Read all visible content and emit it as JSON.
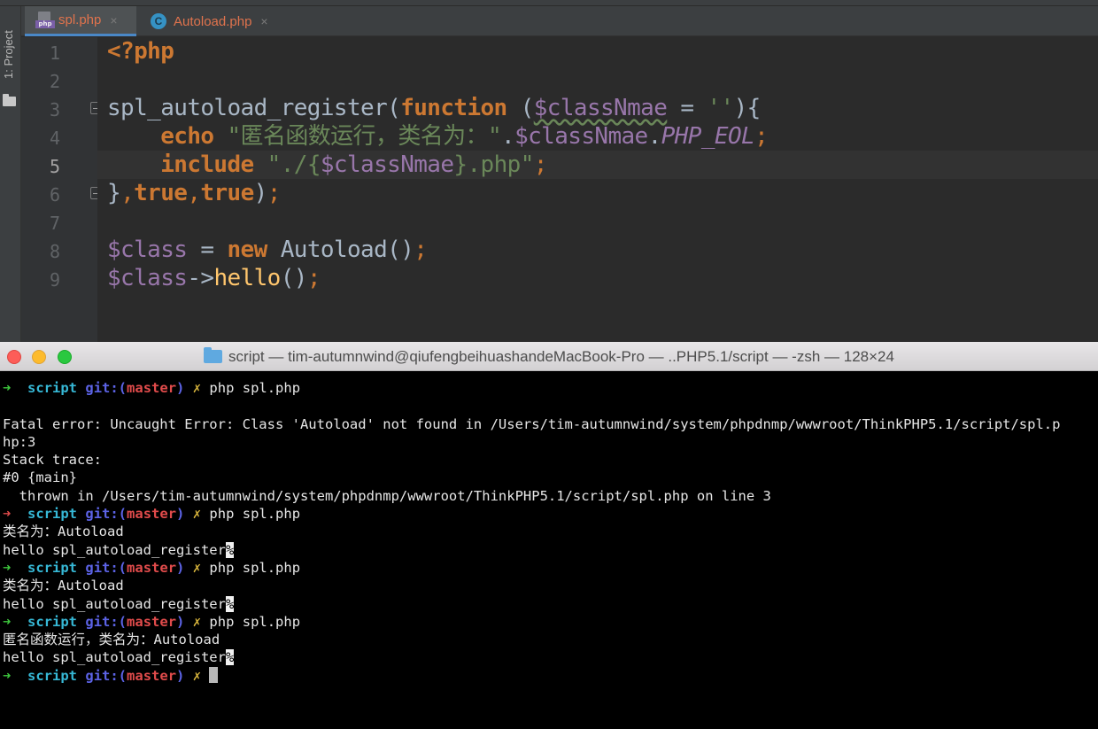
{
  "ide": {
    "project_tab": "1: Project",
    "tabs": [
      {
        "label": "spl.php",
        "icon": "php-file-icon",
        "badge": "php",
        "active": true
      },
      {
        "label": "Autoload.php",
        "icon": "class-icon",
        "glyph": "C",
        "active": false
      }
    ],
    "close_glyph": "×",
    "current_line": 5,
    "line_numbers": [
      "1",
      "2",
      "3",
      "4",
      "5",
      "6",
      "7",
      "8",
      "9"
    ],
    "code": {
      "l1": {
        "tag": "<?php"
      },
      "l3": {
        "fn": "spl_autoload_register",
        "open": "(",
        "kw": "function",
        "space": " (",
        "var": "$classNmae",
        "eq": " = ",
        "str": "''",
        "close": "){"
      },
      "l4": {
        "indent": "    ",
        "kw": "echo",
        "sp": " ",
        "str": "\"匿名函数运行，类名为：\"",
        "dot1": ".",
        "var": "$classNmae",
        "dot2": ".",
        "const": "PHP_EOL",
        "semi": ";"
      },
      "l5": {
        "indent": "    ",
        "kw": "include",
        "sp": " ",
        "str1": "\"./{",
        "var": "$classNmae",
        "str2": "}.php\"",
        "semi": ";"
      },
      "l6": {
        "brace": "}",
        "c1": ",",
        "t1": "true",
        "c2": ",",
        "t2": "true",
        "close": ")",
        "semi": ";"
      },
      "l8": {
        "var": "$class",
        "eq": " = ",
        "kw": "new",
        "cls": " Autoload()",
        "semi": ";"
      },
      "l9": {
        "var": "$class",
        "arrow": "->",
        "fn": "hello",
        "paren": "()",
        "semi": ";"
      }
    }
  },
  "terminal": {
    "title": "script — tim-autumnwind@qiufengbeihuashandeMacBook-Pro — ..PHP5.1/script — -zsh — 128×24",
    "prompt": {
      "arrow": "➜",
      "dir": "script",
      "git": "git:(",
      "branch": "master",
      "git_close": ")",
      "dirty": "✗"
    },
    "lines": {
      "cmd1": "php spl.php",
      "err1": "Fatal error: Uncaught Error: Class 'Autoload' not found in /Users/tim-autumnwind/system/phpdnmp/wwwroot/ThinkPHP5.1/script/spl.p",
      "err2": "hp:3",
      "err3": "Stack trace:",
      "err4": "#0 {main}",
      "err5": "  thrown in /Users/tim-autumnwind/system/phpdnmp/wwwroot/ThinkPHP5.1/script/spl.php on line 3",
      "cmd2": "php spl.php",
      "out2a": "类名为：Autoload",
      "out2b": "hello spl_autoload_register",
      "cmd3": "php spl.php",
      "out3a": "类名为：Autoload",
      "out3b": "hello spl_autoload_register",
      "cmd4": "php spl.php",
      "out4a": "匿名函数运行，类名为：Autoload",
      "out4b": "hello spl_autoload_register",
      "no_newline_mark": "%"
    }
  },
  "colors": {
    "keyword": "#cc7832",
    "variable": "#9876aa",
    "string": "#6a8759",
    "function": "#ffc66d",
    "prompt_arrow": "#3ec83e",
    "prompt_dir": "#36b8d6",
    "prompt_git": "#5c63e6",
    "prompt_branch": "#e04b4b",
    "prompt_dirty": "#d7b43c"
  }
}
